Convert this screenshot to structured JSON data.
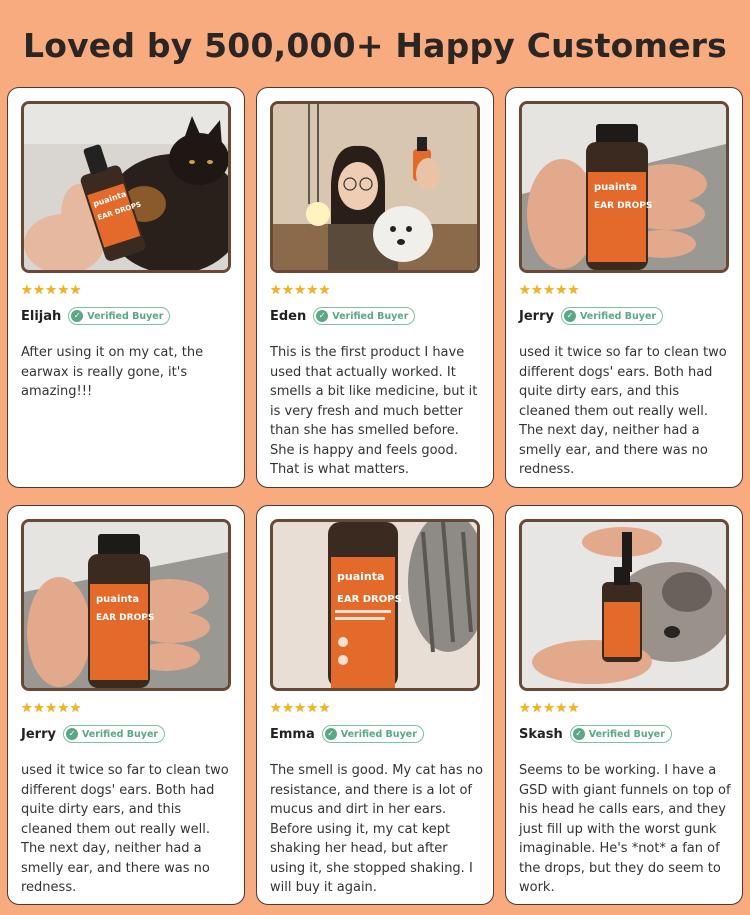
{
  "page": {
    "title": "Loved by 500,000+ Happy Customers",
    "background_color": "#f8ab7e",
    "accent_star_color": "#f2b51f",
    "verified_color": "#5aa886"
  },
  "reviews": [
    {
      "name": "Elijah",
      "stars": "★★★★★",
      "badge": "Verified Buyer",
      "text": "After using it on my cat, the earwax is really gone, it's amazing!!!",
      "photo": "cat-with-ear-drops-bottle"
    },
    {
      "name": "Eden",
      "stars": "★★★★★",
      "badge": "Verified Buyer",
      "text": "This is the first product I have used that actually worked. It smells a bit like medicine, but it is very fresh and much better than she has smelled before. She is happy and feels good. That is what matters.",
      "photo": "woman-with-poodle-and-bottle"
    },
    {
      "name": "Jerry",
      "stars": "★★★★★",
      "badge": "Verified Buyer",
      "text": "used it twice so far to clean two different dogs' ears. Both had quite dirty ears, and this cleaned them out really well. The next day, neither had a smelly ear, and there was no redness.",
      "photo": "hand-holding-ear-drops-bottle"
    },
    {
      "name": "Jerry",
      "stars": "★★★★★",
      "badge": "Verified Buyer",
      "text": "used it twice so far to clean two different dogs' ears. Both had quite dirty ears, and this cleaned them out really well. The next day, neither had a smelly ear, and there was no redness.",
      "photo": "hand-holding-ear-drops-bottle"
    },
    {
      "name": "Emma",
      "stars": "★★★★★",
      "badge": "Verified Buyer",
      "text": "The smell is good. My cat has no resistance, and there is a lot of mucus and dirt in her ears. Before using it, my cat kept shaking her head, but after using it, she stopped shaking. I will buy it again.",
      "photo": "bottle-with-tabby-cat"
    },
    {
      "name": "Skash",
      "stars": "★★★★★",
      "badge": "Verified Buyer",
      "text": "Seems to be working. I have a GSD with giant funnels on top of his head he calls ears, and they just fill up with the worst gunk imaginable. He's *not* a fan of the drops, but they do seem to work.",
      "photo": "dropper-over-dog"
    }
  ],
  "product_label": {
    "brand": "puainta",
    "product": "EAR DROPS"
  }
}
